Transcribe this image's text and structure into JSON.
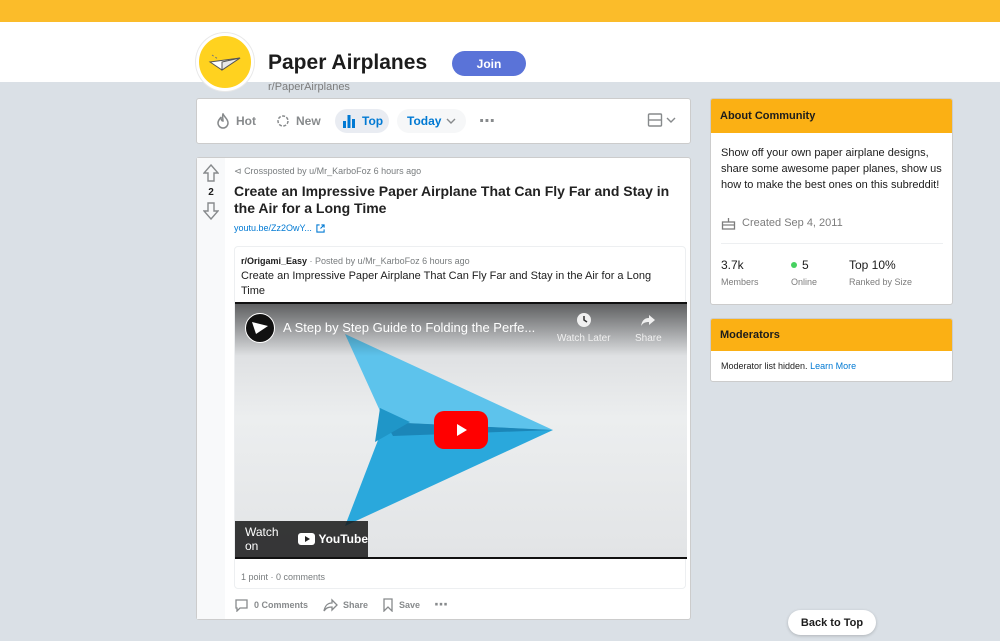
{
  "header": {
    "title": "Paper Airplanes",
    "handle": "r/PaperAirplanes",
    "join_label": "Join"
  },
  "sort_bar": {
    "items": [
      {
        "label": "Hot",
        "icon": "flame-icon"
      },
      {
        "label": "New",
        "icon": "sparkle-icon"
      },
      {
        "label": "Top",
        "icon": "bar-chart-icon",
        "active": true
      },
      {
        "label": "Today",
        "icon": "chevron-down-icon"
      }
    ],
    "more": "⋯"
  },
  "post": {
    "votes": "2",
    "crosspost": "Crossposted by u/Mr_KarboFoz 6 hours ago",
    "title": "Create an Impressive Paper Airplane That Can Fly Far and Stay in the Air for a Long Time",
    "link": "youtu.be/Zz2OwY...",
    "inner": {
      "subreddit": "r/Origami_Easy",
      "meta": " · Posted by u/Mr_KarboFoz 6 hours ago",
      "title": "Create an Impressive Paper Airplane That Can Fly Far and Stay in the Air for a Long Time",
      "video_title": "A Step by Step Guide to Folding the Perfe...",
      "watch_later": "Watch Later",
      "share": "Share",
      "watch_on": "Watch on",
      "youtube": "YouTube",
      "footer": "1 point · 0 comments"
    },
    "actions": {
      "comments": "0 Comments",
      "share": "Share",
      "save": "Save",
      "more": "⋯"
    }
  },
  "about": {
    "heading": "About Community",
    "description": "Show off your own paper airplane designs, share some awesome paper planes, show us how to make the best ones on this subreddit!",
    "created": "Created Sep 4, 2011",
    "stats": [
      {
        "value": "3.7k",
        "label": "Members"
      },
      {
        "value": "5",
        "label": "Online"
      },
      {
        "value": "Top 10%",
        "label": "Ranked by Size"
      }
    ]
  },
  "moderators": {
    "heading": "Moderators",
    "text": "Moderator list hidden.",
    "link": "Learn More"
  },
  "back_to_top": "Back to Top",
  "colors": {
    "brand_yellow": "#fbbc2a",
    "join_blue": "#5a73d8",
    "link_blue": "#0079d3",
    "youtube_red": "#ff0000",
    "plane_blue": "#2aa8dc"
  }
}
